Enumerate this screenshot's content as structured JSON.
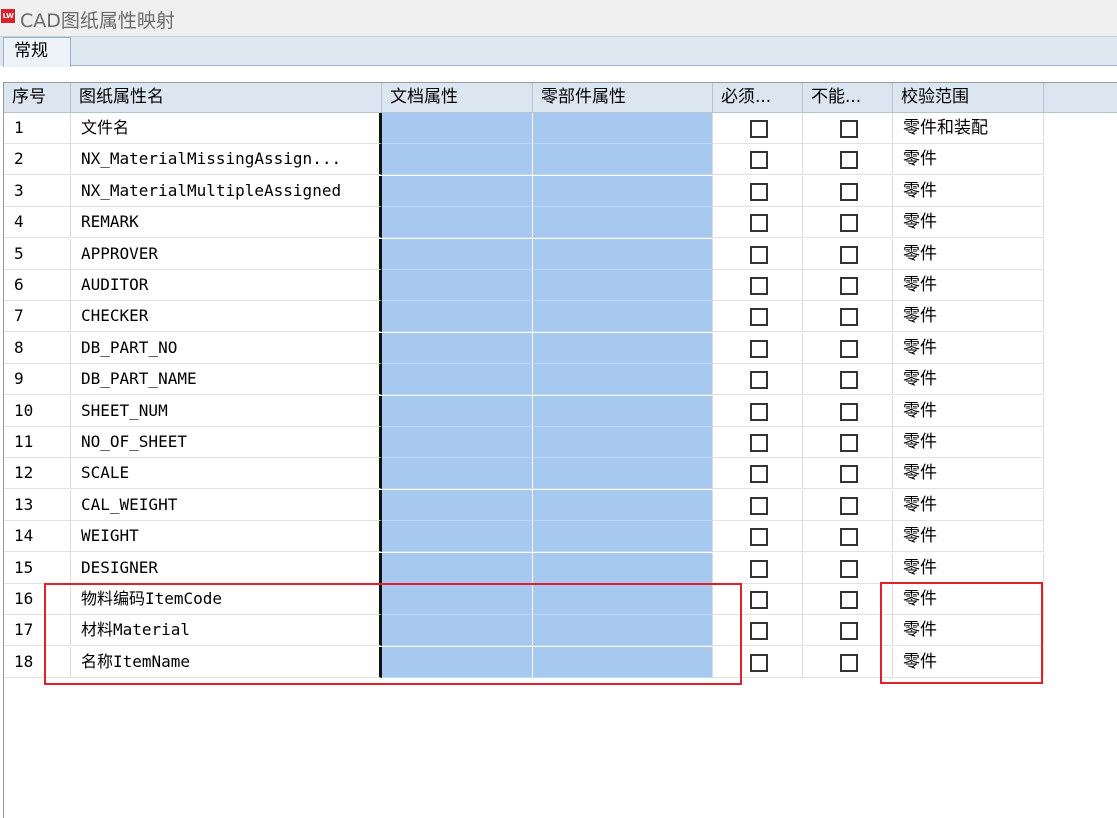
{
  "window": {
    "title": "CAD图纸属性映射",
    "logo_text": "LW",
    "logo_color": "#d6242b"
  },
  "tabs": [
    {
      "label": "常规",
      "selected": true
    }
  ],
  "table": {
    "columns": [
      "序号",
      "图纸属性名",
      "文档属性",
      "零部件属性",
      "必须...",
      "不能...",
      "校验范围"
    ],
    "rows": [
      {
        "seq": "1",
        "name": "文件名",
        "doc": "",
        "part": "",
        "required": false,
        "not_null": false,
        "scope": "零件和装配"
      },
      {
        "seq": "2",
        "name": "NX_MaterialMissingAssign...",
        "doc": "",
        "part": "",
        "required": false,
        "not_null": false,
        "scope": "零件"
      },
      {
        "seq": "3",
        "name": "NX_MaterialMultipleAssigned",
        "doc": "",
        "part": "",
        "required": false,
        "not_null": false,
        "scope": "零件"
      },
      {
        "seq": "4",
        "name": "REMARK",
        "doc": "",
        "part": "",
        "required": false,
        "not_null": false,
        "scope": "零件"
      },
      {
        "seq": "5",
        "name": "APPROVER",
        "doc": "",
        "part": "",
        "required": false,
        "not_null": false,
        "scope": "零件"
      },
      {
        "seq": "6",
        "name": "AUDITOR",
        "doc": "",
        "part": "",
        "required": false,
        "not_null": false,
        "scope": "零件"
      },
      {
        "seq": "7",
        "name": "CHECKER",
        "doc": "",
        "part": "",
        "required": false,
        "not_null": false,
        "scope": "零件"
      },
      {
        "seq": "8",
        "name": "DB_PART_NO",
        "doc": "",
        "part": "",
        "required": false,
        "not_null": false,
        "scope": "零件"
      },
      {
        "seq": "9",
        "name": "DB_PART_NAME",
        "doc": "",
        "part": "",
        "required": false,
        "not_null": false,
        "scope": "零件"
      },
      {
        "seq": "10",
        "name": "SHEET_NUM",
        "doc": "",
        "part": "",
        "required": false,
        "not_null": false,
        "scope": "零件"
      },
      {
        "seq": "11",
        "name": "NO_OF_SHEET",
        "doc": "",
        "part": "",
        "required": false,
        "not_null": false,
        "scope": "零件"
      },
      {
        "seq": "12",
        "name": "SCALE",
        "doc": "",
        "part": "",
        "required": false,
        "not_null": false,
        "scope": "零件"
      },
      {
        "seq": "13",
        "name": "CAL_WEIGHT",
        "doc": "",
        "part": "",
        "required": false,
        "not_null": false,
        "scope": "零件"
      },
      {
        "seq": "14",
        "name": "WEIGHT",
        "doc": "",
        "part": "",
        "required": false,
        "not_null": false,
        "scope": "零件"
      },
      {
        "seq": "15",
        "name": "DESIGNER",
        "doc": "",
        "part": "",
        "required": false,
        "not_null": false,
        "scope": "零件"
      },
      {
        "seq": "16",
        "name": "物料编码ItemCode",
        "doc": "",
        "part": "",
        "required": false,
        "not_null": false,
        "scope": "零件"
      },
      {
        "seq": "17",
        "name": "材料Material",
        "doc": "",
        "part": "",
        "required": false,
        "not_null": false,
        "scope": "零件"
      },
      {
        "seq": "18",
        "name": "名称ItemName",
        "doc": "",
        "part": "",
        "required": false,
        "not_null": false,
        "scope": "零件"
      }
    ]
  },
  "annotations": {
    "highlight_color": "#e0202a"
  }
}
